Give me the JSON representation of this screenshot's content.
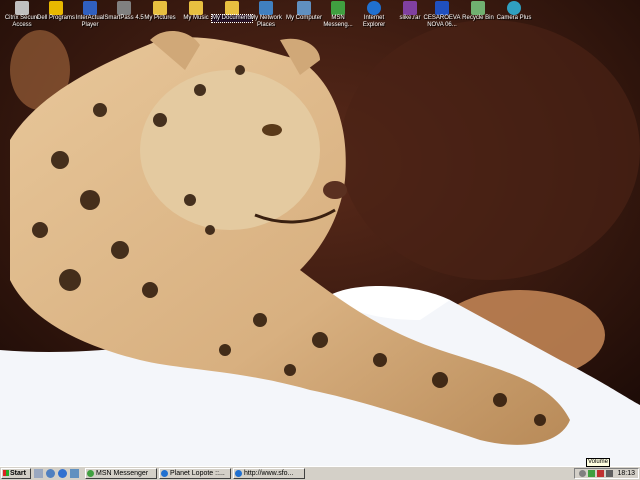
{
  "desktop_icons": [
    {
      "label": "Citrix Secure Access",
      "icon": "citrix-icon",
      "color": "#c0c0c0"
    },
    {
      "label": "Dell Programs",
      "icon": "dell-icon",
      "color": "#e8b800"
    },
    {
      "label": "InterActual Player",
      "icon": "interactual-icon",
      "color": "#3060c0"
    },
    {
      "label": "SmartPass 4.5",
      "icon": "smartpass-icon",
      "color": "#808080"
    },
    {
      "label": "My Pictures",
      "icon": "folder-icon",
      "color": "#e8c040"
    },
    {
      "label": "My Music",
      "icon": "folder-icon",
      "color": "#e8c040"
    },
    {
      "label": "My Documents",
      "icon": "folder-icon",
      "color": "#e8c040"
    },
    {
      "label": "My Network Places",
      "icon": "network-icon",
      "color": "#4080c0"
    },
    {
      "label": "My Computer",
      "icon": "computer-icon",
      "color": "#6090c0"
    },
    {
      "label": "MSN Messeng...",
      "icon": "msn-icon",
      "color": "#40a040"
    },
    {
      "label": "Internet Explorer",
      "icon": "ie-icon",
      "color": "#2070d0"
    },
    {
      "label": "slike.rar",
      "icon": "rar-icon",
      "color": "#8040a0"
    },
    {
      "label": "CESAROEVA NOVA 06...",
      "icon": "word-doc-icon",
      "color": "#2050c0"
    },
    {
      "label": "Recycle Bin",
      "icon": "recycle-bin-icon",
      "color": "#70b070"
    },
    {
      "label": "Camera Plus",
      "icon": "camera-icon",
      "color": "#30a0c0"
    }
  ],
  "taskbar": {
    "start_label": "Start",
    "tasks": [
      {
        "label": "MSN Messenger",
        "icon": "msn-icon",
        "color": "#40a040"
      },
      {
        "label": "Planet Lopote ::...",
        "icon": "ie-icon",
        "color": "#2070d0"
      },
      {
        "label": "http://www.sfo...",
        "icon": "ie-icon",
        "color": "#2070d0"
      }
    ],
    "clock": "18:13",
    "tooltip": "Volume"
  }
}
